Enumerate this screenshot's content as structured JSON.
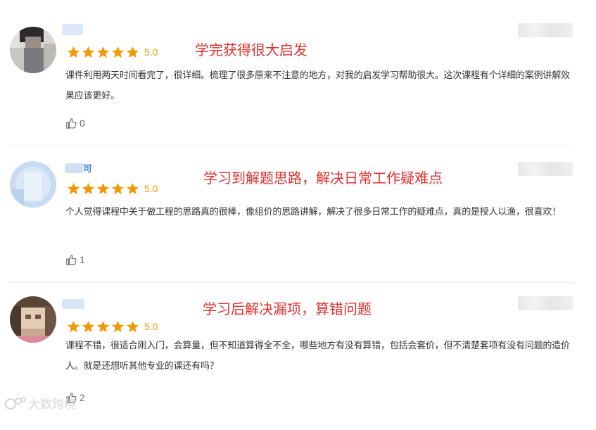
{
  "reviews": [
    {
      "rating": "5.0",
      "headline": "学完获得很大启发",
      "body": "课件利用两天时间看完了，很详细。梳理了很多原来不注意的地方，对我的启发学习帮助很大。这次课程有个详细的案例讲解效果应该更好。",
      "likes": "0"
    },
    {
      "name_suffix": "可",
      "rating": "5.0",
      "headline": "学习到解题思路，解决日常工作疑难点",
      "body": "个人觉得课程中关于做工程的思路真的很棒，像组价的思路讲解，解决了很多日常工作的疑难点，真的是授人以渔，很喜欢！",
      "likes": "1"
    },
    {
      "rating": "5.0",
      "headline": "学习后解决漏项，算错问题",
      "body": "课程不错，很适合刚入门，会算量，但不知道算得全不全，哪些地方有没有算错，包括会套价，但不清楚套项有没有问题的造价人。就是还想听其他专业的课还有吗？",
      "likes": "2"
    }
  ],
  "watermark": {
    "text": "大数跨境",
    "icon": "logo-icon"
  },
  "colors": {
    "star": "#f39800",
    "headline": "#e0312f",
    "name": "#3a7bd5"
  }
}
